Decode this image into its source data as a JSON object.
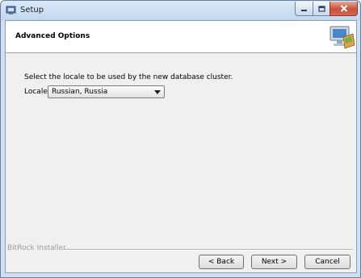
{
  "window": {
    "title": "Setup",
    "app_icon": "installer-icon",
    "controls": [
      "minimize-icon",
      "maximize-icon",
      "close-icon"
    ]
  },
  "header": {
    "title": "Advanced Options",
    "icon": "computer-install-icon"
  },
  "main": {
    "prompt": "Select the locale to be used by the new database cluster.",
    "locale_label": "Locale",
    "locale_value": "Russian, Russia"
  },
  "footer": {
    "brand": "BitRock Installer",
    "back_label": "< Back",
    "next_label": "Next >",
    "cancel_label": "Cancel"
  },
  "colors": {
    "titlebar": "#c2d7ee",
    "close_button": "#c7503a",
    "client_bg": "#f0f0f0"
  }
}
